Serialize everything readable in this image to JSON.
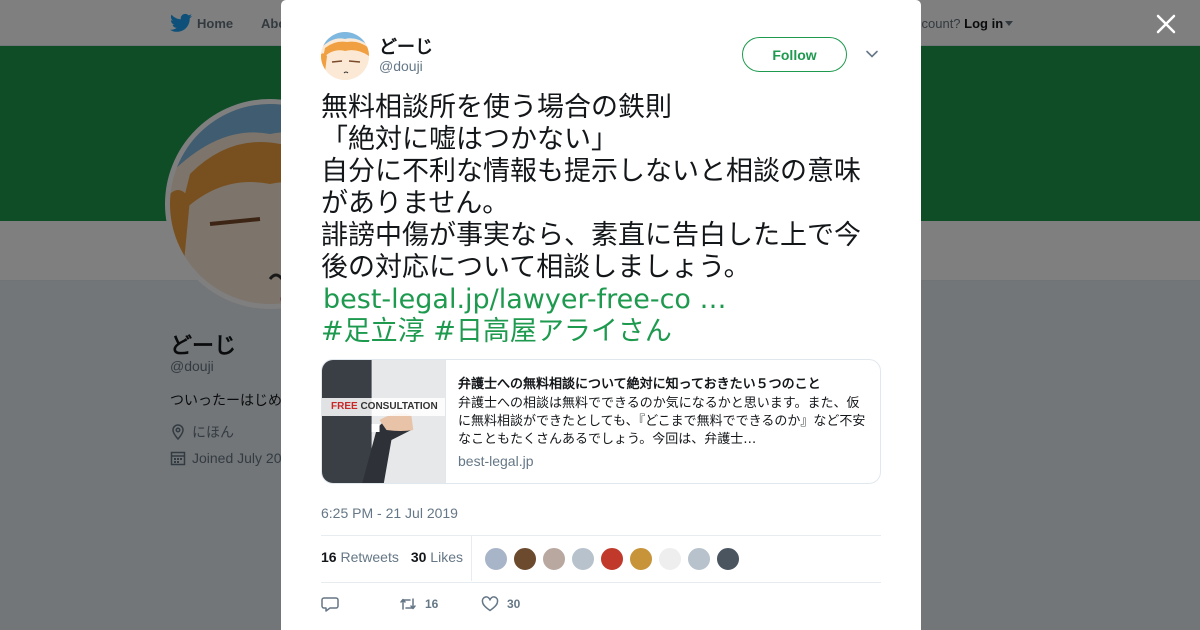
{
  "nav": {
    "home_label": "Home",
    "about_label": "Abo",
    "account_prompt": "ccount?",
    "login_label": "Log in"
  },
  "profile": {
    "name": "どーじ",
    "handle": "@douji",
    "bio": "ついったーはじめ",
    "location": "にほん",
    "joined": "Joined July 20"
  },
  "tweet": {
    "author_name": "どーじ",
    "author_handle": "@douji",
    "follow_label": "Follow",
    "text_lines": [
      "無料相談所を使う場合の鉄則",
      "「絶対に嘘はつかない」",
      "自分に不利な情報も提示しないと相談の意味",
      "がありません。",
      "誹謗中傷が事実なら、素直に告白した上で今",
      "後の対応について相談しましょう。"
    ],
    "link_text": "best-legal.jp/lawyer-free-co …",
    "hashtags": [
      "#足立淳",
      "#日高屋アライさん"
    ],
    "card": {
      "image_label_free": "FREE",
      "image_label_rest": " CONSULTATION",
      "title": "弁護士への無料相談について絶対に知っておきたい５つのこと",
      "description": "弁護士への相談は無料でできるのか気になるかと思います。また、仮に無料相談ができたとしても、『どこまで無料でできるのか』など不安なこともたくさんあるでしょう。今回は、弁護士…",
      "domain": "best-legal.jp"
    },
    "timestamp": "6:25 PM - 21 Jul 2019",
    "retweets_count": "16",
    "retweets_label": "Retweets",
    "likes_count": "30",
    "likes_label": "Likes",
    "liker_avatar_colors": [
      "#a8b4c8",
      "#6b4a2e",
      "#b9a8a0",
      "#b8c2cc",
      "#c0392b",
      "#c8943a",
      "#eeeeee",
      "#b8c2cc",
      "#4a5560"
    ],
    "actions": {
      "reply_icon": "reply-icon",
      "retweet_count": "16",
      "like_count": "30"
    }
  },
  "colors": {
    "accent": "#1e9a4f",
    "text": "#14171a",
    "muted": "#657786",
    "banner": "#1e9a4f"
  }
}
